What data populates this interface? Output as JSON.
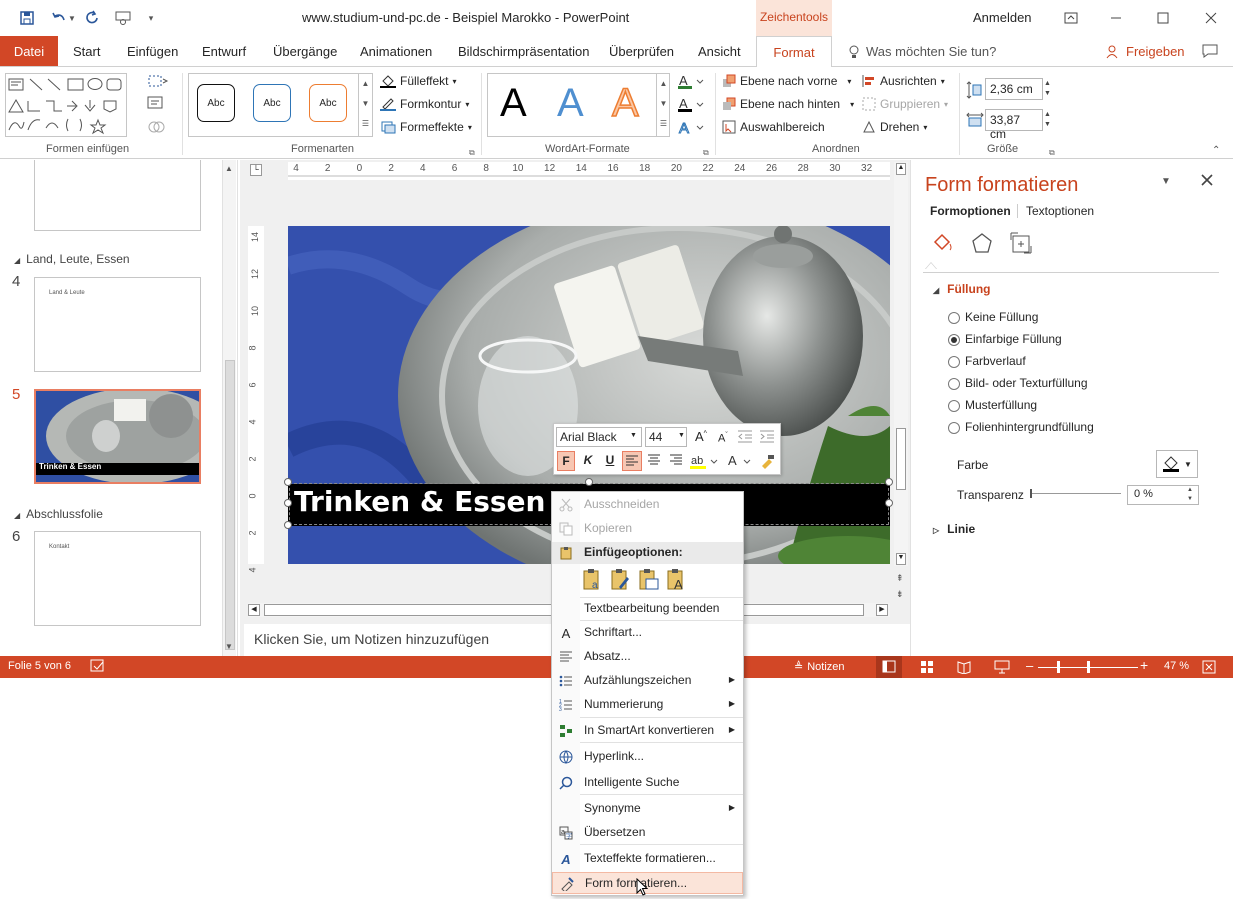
{
  "window": {
    "title": "www.studium-und-pc.de - Beispiel Marokko  -  PowerPoint",
    "context_group": "Zeichentools",
    "signin": "Anmelden"
  },
  "tabs": {
    "file": "Datei",
    "items": [
      "Start",
      "Einfügen",
      "Entwurf",
      "Übergänge",
      "Animationen",
      "Bildschirmpräsentation",
      "Überprüfen",
      "Ansicht"
    ],
    "active": "Format",
    "tell_me": "Was möchten Sie tun?",
    "share": "Freigeben"
  },
  "ribbon": {
    "groups": {
      "shapes": "Formen einfügen",
      "styles": "Formenarten",
      "wordart": "WordArt-Formate",
      "arrange": "Anordnen",
      "size": "Größe"
    },
    "abc_label": "Abc",
    "fill": "Fülleffekt",
    "outline": "Formkontur",
    "effects": "Formeffekte",
    "wordart_letter": "A",
    "bring_forward": "Ebene nach vorne",
    "send_backward": "Ebene nach hinten",
    "selection_pane": "Auswahlbereich",
    "align": "Ausrichten",
    "group": "Gruppieren",
    "rotate": "Drehen",
    "height": "2,36  cm",
    "width": "33,87  cm"
  },
  "slides": {
    "sections": [
      "Land, Leute, Essen",
      "Abschlussfolie"
    ],
    "thumbs": [
      {
        "num": "4",
        "text": "Land & Leute"
      },
      {
        "num": "5",
        "text": "Trinken & Essen"
      },
      {
        "num": "6",
        "text": "Kontakt"
      }
    ]
  },
  "slide": {
    "title": "Trinken & Essen"
  },
  "ruler": {
    "h": [
      "4",
      "2",
      "0",
      "2",
      "4",
      "6",
      "8",
      "10",
      "12",
      "14",
      "16",
      "18",
      "20",
      "22",
      "24",
      "26",
      "28",
      "30",
      "32"
    ],
    "v": [
      "14",
      "12",
      "10",
      "8",
      "6",
      "4",
      "2",
      "0",
      "2",
      "4"
    ]
  },
  "notes_placeholder": "Klicken Sie, um Notizen hinzuzufügen",
  "status": {
    "slide": "Folie 5 von 6",
    "notes": "Notizen",
    "zoom": "47 %"
  },
  "format_pane": {
    "title": "Form formatieren",
    "tab_shape": "Formoptionen",
    "tab_text": "Textoptionen",
    "section_fill": "Füllung",
    "options": [
      "Keine Füllung",
      "Einfarbige Füllung",
      "Farbverlauf",
      "Bild- oder Texturfüllung",
      "Musterfüllung",
      "Folienhintergrundfüllung"
    ],
    "selected_index": 1,
    "color_label": "Farbe",
    "transparency_label": "Transparenz",
    "transparency_value": "0 %",
    "section_line": "Linie"
  },
  "mini_toolbar": {
    "font": "Arial Black",
    "size": "44",
    "bold": "F",
    "italic": "K",
    "underline": "U"
  },
  "context_menu": {
    "items": [
      {
        "label": "Ausschneiden",
        "icon": "scissors-icon",
        "disabled": true
      },
      {
        "label": "Kopieren",
        "icon": "copy-icon",
        "disabled": true
      },
      {
        "label": "Einfügeoptionen:",
        "icon": "paste-icon",
        "header": true
      },
      {
        "label": "Textbearbeitung beenden"
      },
      {
        "label": "Schriftart...",
        "icon": "font-icon"
      },
      {
        "label": "Absatz...",
        "icon": "paragraph-icon"
      },
      {
        "label": "Aufzählungszeichen",
        "icon": "bullets-icon",
        "submenu": true
      },
      {
        "label": "Nummerierung",
        "icon": "numbering-icon",
        "submenu": true
      },
      {
        "label": "In SmartArt konvertieren",
        "icon": "smartart-icon",
        "submenu": true
      },
      {
        "label": "Hyperlink...",
        "icon": "hyperlink-icon"
      },
      {
        "label": "Intelligente Suche",
        "icon": "search-icon"
      },
      {
        "label": "Synonyme",
        "submenu": true
      },
      {
        "label": "Übersetzen",
        "icon": "translate-icon"
      },
      {
        "label": "Texteffekte formatieren...",
        "icon": "text-effects-icon"
      },
      {
        "label": "Form formatieren...",
        "icon": "format-shape-icon",
        "highlighted": true
      }
    ]
  },
  "colors": {
    "accent": "#d24726",
    "context_bg": "#fbe4d9",
    "context_text": "#c8431e"
  }
}
